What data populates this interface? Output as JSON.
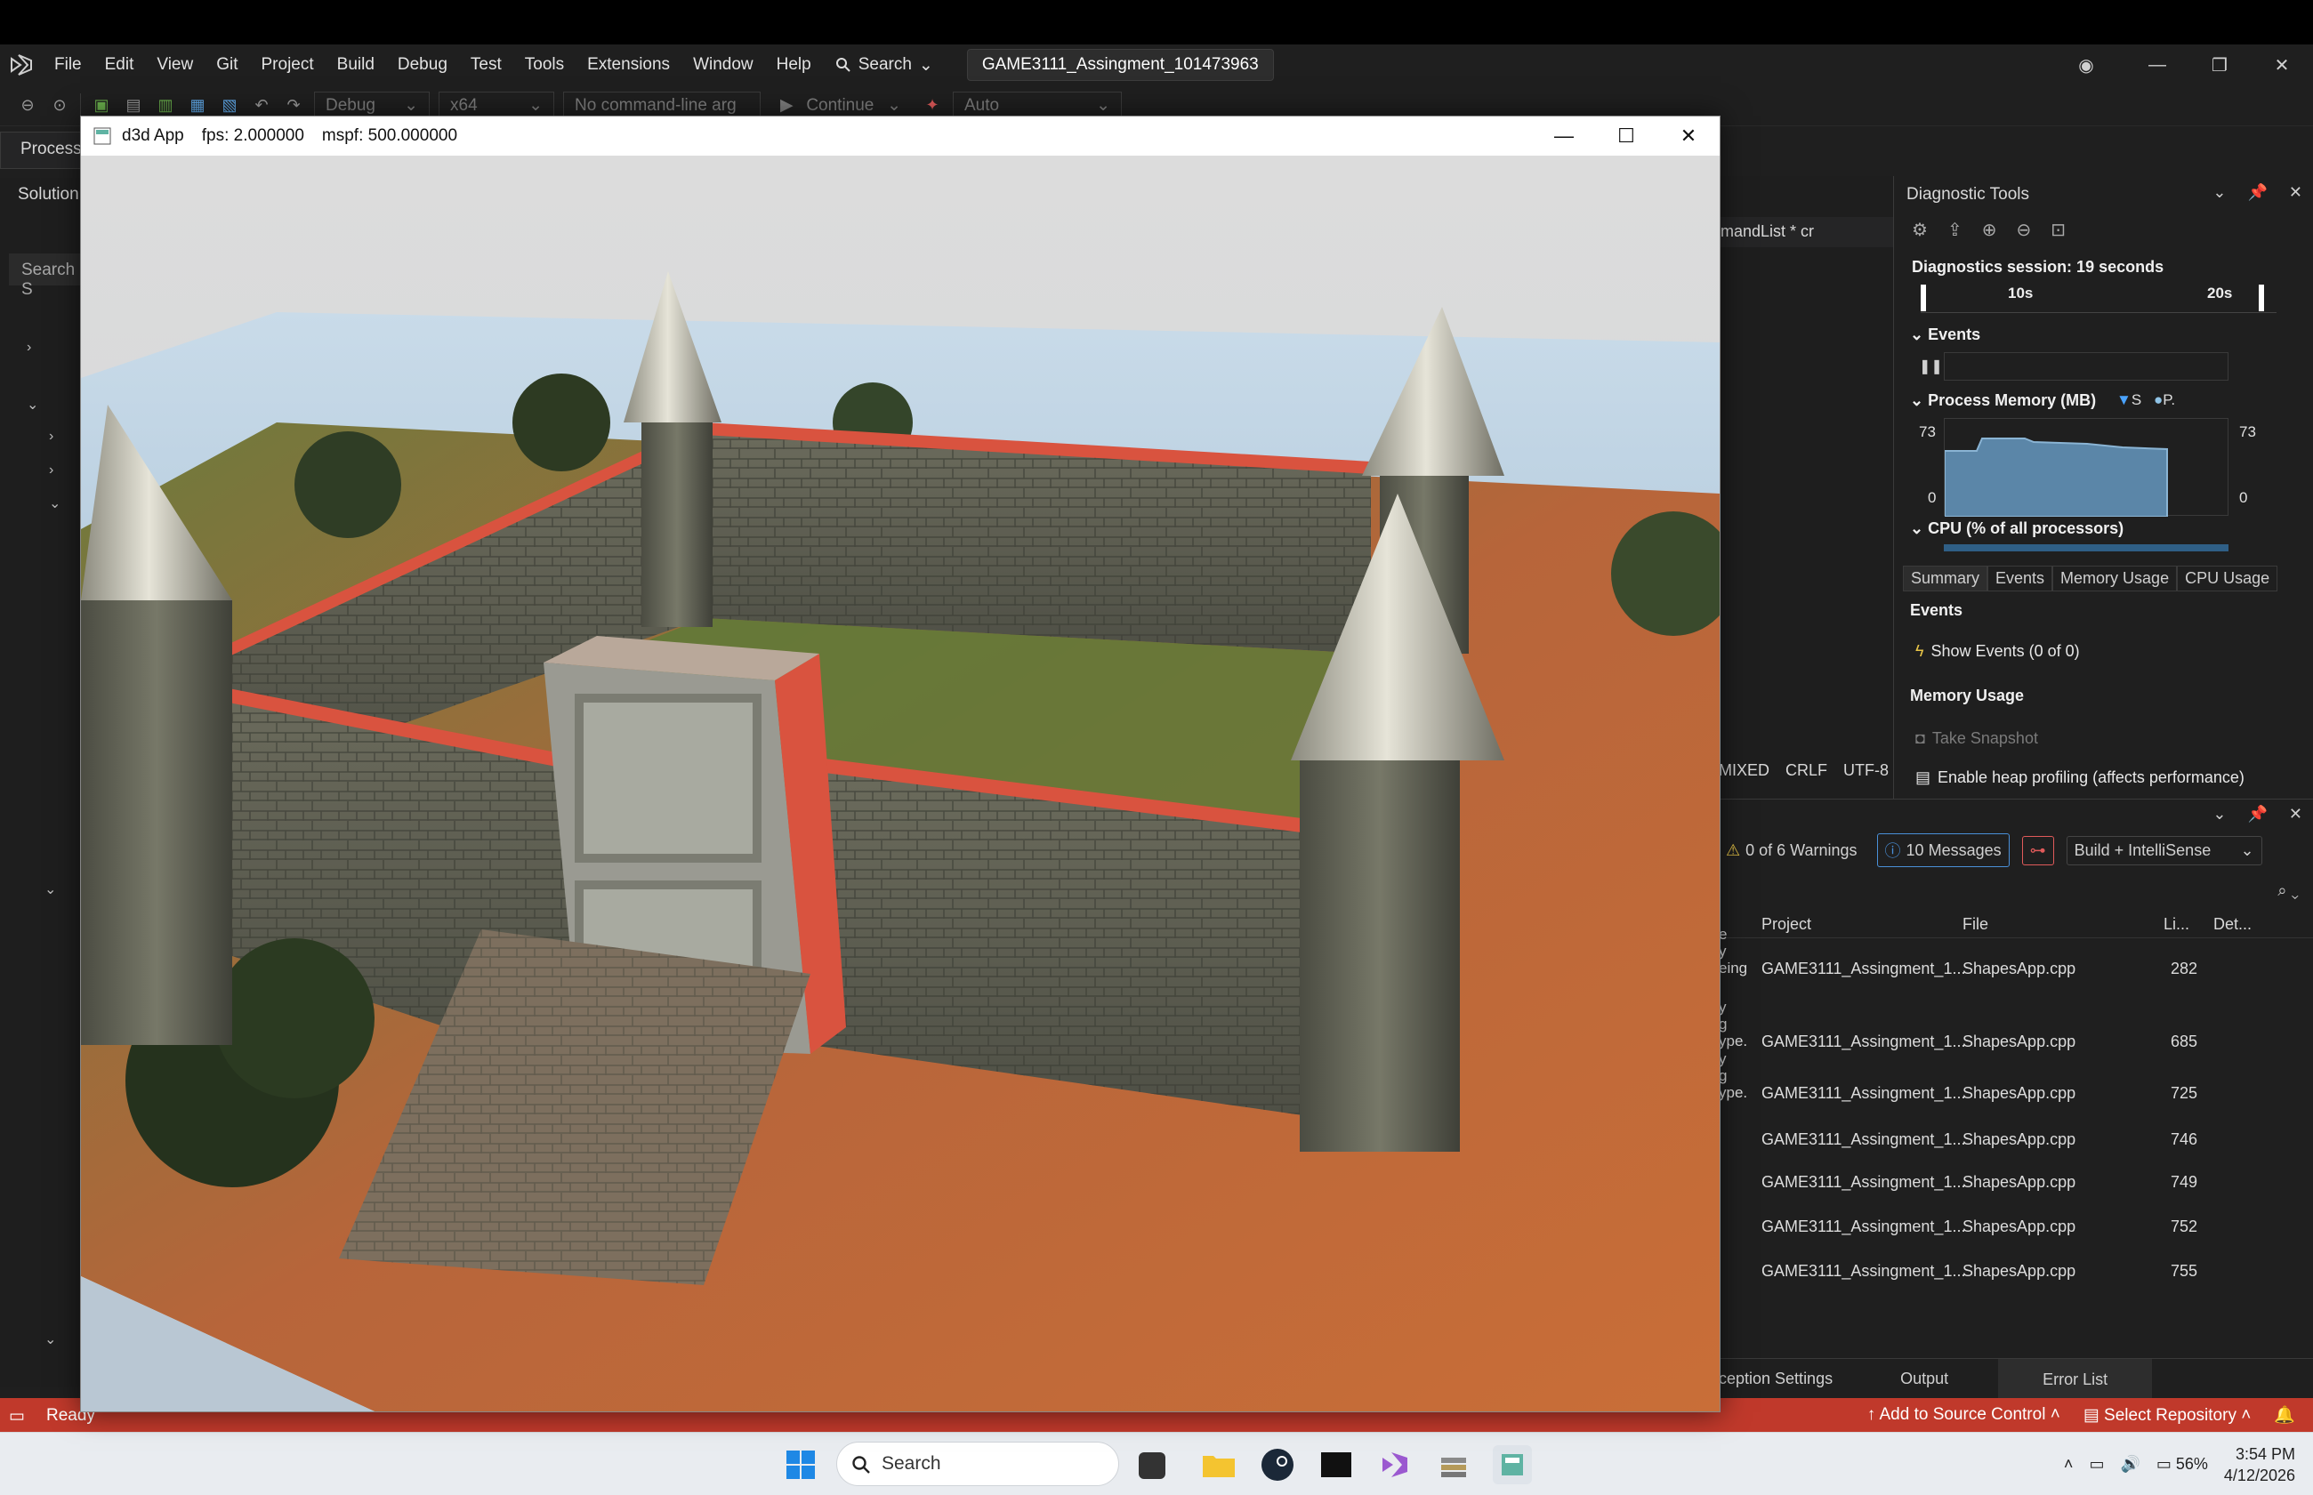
{
  "menubar": {
    "items": [
      "File",
      "Edit",
      "View",
      "Git",
      "Project",
      "Build",
      "Debug",
      "Test",
      "Tools",
      "Extensions",
      "Window",
      "Help"
    ],
    "search_label": "Search",
    "solution_title": "GAME3111_Assingment_101473963"
  },
  "toolbar": {
    "config": "Debug",
    "platform": "x64",
    "cmdline": "No command-line arg",
    "continue_label": "Continue",
    "auto": "Auto"
  },
  "left": {
    "process_label": "Process:",
    "solution_label": "Solution",
    "search_placeholder": "Search S"
  },
  "d3d_window": {
    "app_name": "d3d App",
    "fps": "fps: 2.000000",
    "mspf": "mspf: 500.000000"
  },
  "editor": {
    "tab_label": "mandList * cr",
    "encoding": [
      "MIXED",
      "CRLF",
      "UTF-8"
    ]
  },
  "diagnostics": {
    "title": "Diagnostic Tools",
    "session": "Diagnostics session: 19 seconds",
    "timeline_ticks": [
      "10s",
      "20s"
    ],
    "events_label": "Events",
    "process_memory_label": "Process Memory (MB)",
    "legend": [
      "S",
      "P."
    ],
    "mem_max": "73",
    "mem_min": "0",
    "cpu_label": "CPU (% of all processors)",
    "tabs": [
      "Summary",
      "Events",
      "Memory Usage",
      "CPU Usage"
    ],
    "events_sub": "Events",
    "show_events": "Show Events (0 of 0)",
    "memory_usage_sub": "Memory Usage",
    "take_snapshot": "Take Snapshot",
    "heap_profiling": "Enable heap profiling (affects performance)"
  },
  "errorlist": {
    "warnings": "0 of 6 Warnings",
    "messages": "10 Messages",
    "scope": "Build + IntelliSense",
    "columns": [
      "Project",
      "File",
      "Li...",
      "Det..."
    ],
    "rows": [
      {
        "desc": [
          "e",
          "y",
          "eing"
        ],
        "project": "GAME3111_Assingment_1...",
        "file": "ShapesApp.cpp",
        "line": "282"
      },
      {
        "desc": [
          "y",
          "g",
          "ype."
        ],
        "project": "GAME3111_Assingment_1...",
        "file": "ShapesApp.cpp",
        "line": "685"
      },
      {
        "desc": [
          "y",
          "g",
          "ype."
        ],
        "project": "GAME3111_Assingment_1...",
        "file": "ShapesApp.cpp",
        "line": "725"
      },
      {
        "desc": [],
        "project": "GAME3111_Assingment_1...",
        "file": "ShapesApp.cpp",
        "line": "746"
      },
      {
        "desc": [],
        "project": "GAME3111_Assingment_1...",
        "file": "ShapesApp.cpp",
        "line": "749"
      },
      {
        "desc": [],
        "project": "GAME3111_Assingment_1...",
        "file": "ShapesApp.cpp",
        "line": "752"
      },
      {
        "desc": [],
        "project": "GAME3111_Assingment_1...",
        "file": "ShapesApp.cpp",
        "line": "755"
      }
    ],
    "bottom_tabs": [
      "ception Settings",
      "Output",
      "Error List"
    ]
  },
  "statusbar": {
    "ready": "Ready",
    "source_control": "Add to Source Control",
    "repository": "Select Repository"
  },
  "taskbar": {
    "search": "Search",
    "battery": "56%",
    "time": "3:54 PM",
    "date": "4/12/2026"
  },
  "colors": {
    "status_accent": "#c0392b",
    "memory_fill": "#5b86a8",
    "wall_trim": "#d9533f"
  }
}
